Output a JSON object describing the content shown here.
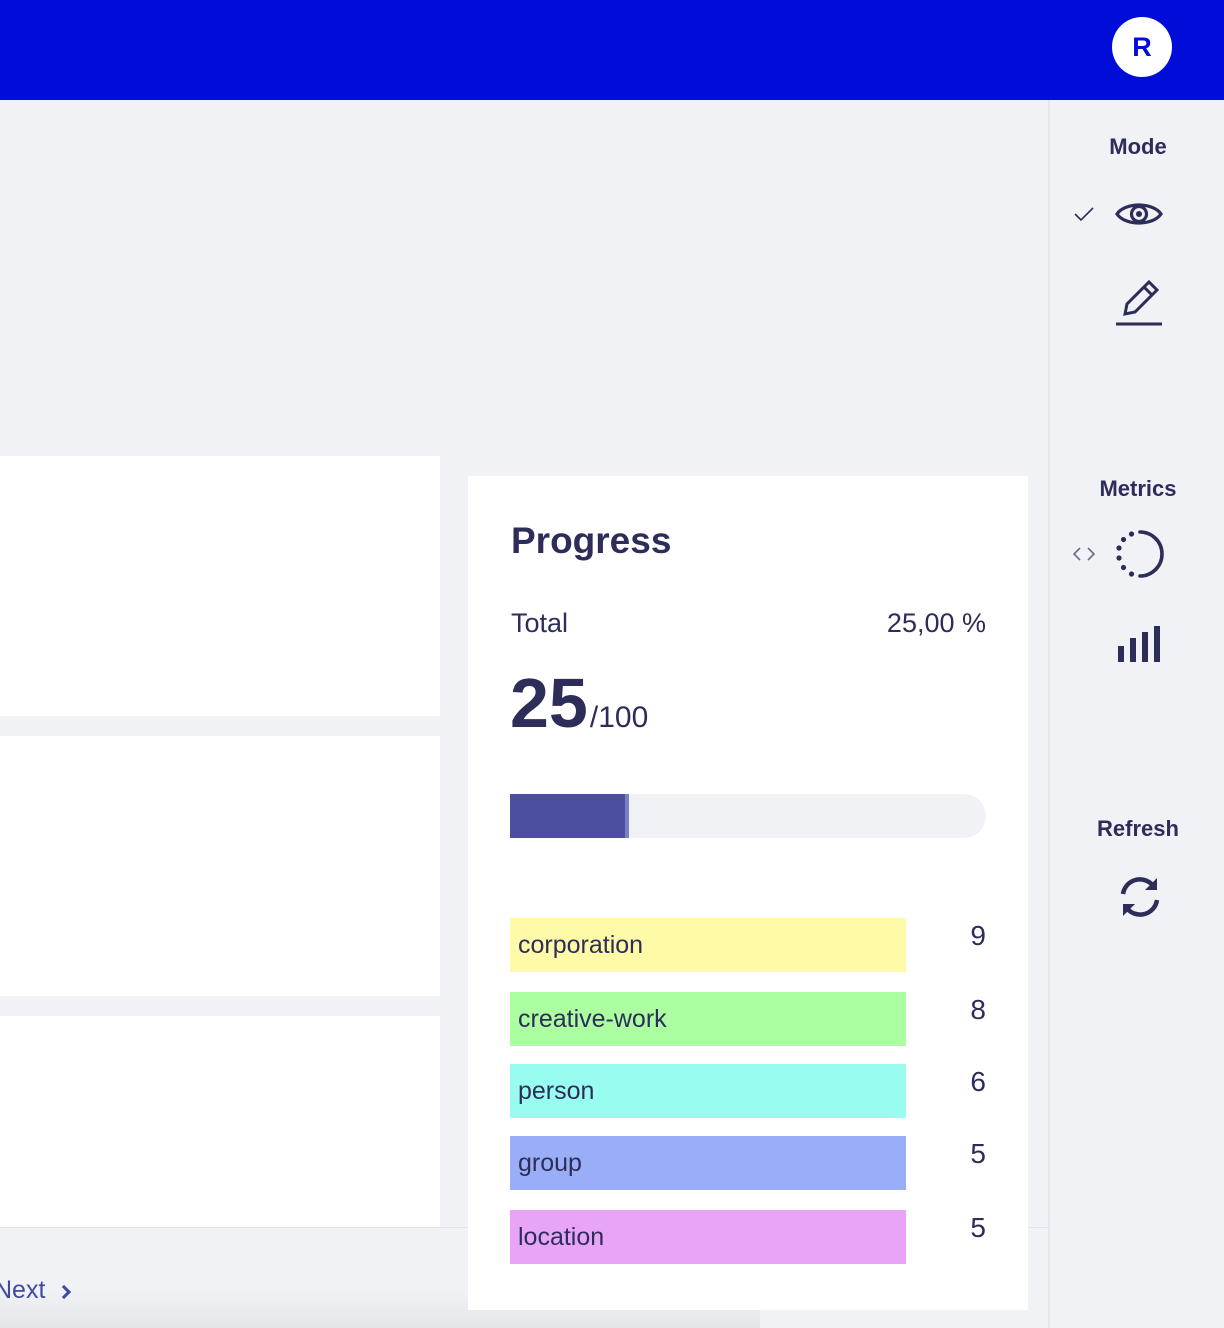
{
  "header": {
    "avatar_initial": "R",
    "color": "#000cd8"
  },
  "main": {
    "next_label": "Next"
  },
  "progress": {
    "title": "Progress",
    "total_label": "Total",
    "total_percent": "25,00 %",
    "count": "25",
    "count_total": "/100",
    "fraction": 0.25,
    "bar_color": "#4b4f9e",
    "labels": [
      {
        "name": "corporation",
        "count": "9",
        "color": "#fffaa8"
      },
      {
        "name": "creative-work",
        "count": "8",
        "color": "#acffa1"
      },
      {
        "name": "person",
        "count": "6",
        "color": "#99fcf0"
      },
      {
        "name": "group",
        "count": "5",
        "color": "#9aaef7"
      },
      {
        "name": "location",
        "count": "5",
        "color": "#e8a5f7"
      }
    ]
  },
  "sidebar": {
    "mode_heading": "Mode",
    "mode_items": [
      {
        "icon": "eye-icon",
        "selected": true
      },
      {
        "icon": "pencil-icon",
        "selected": false
      }
    ],
    "metrics_heading": "Metrics",
    "metrics_items": [
      {
        "icon": "progress-circle-icon"
      },
      {
        "icon": "bar-chart-icon"
      }
    ],
    "refresh_heading": "Refresh",
    "refresh_icon": "refresh-icon"
  }
}
